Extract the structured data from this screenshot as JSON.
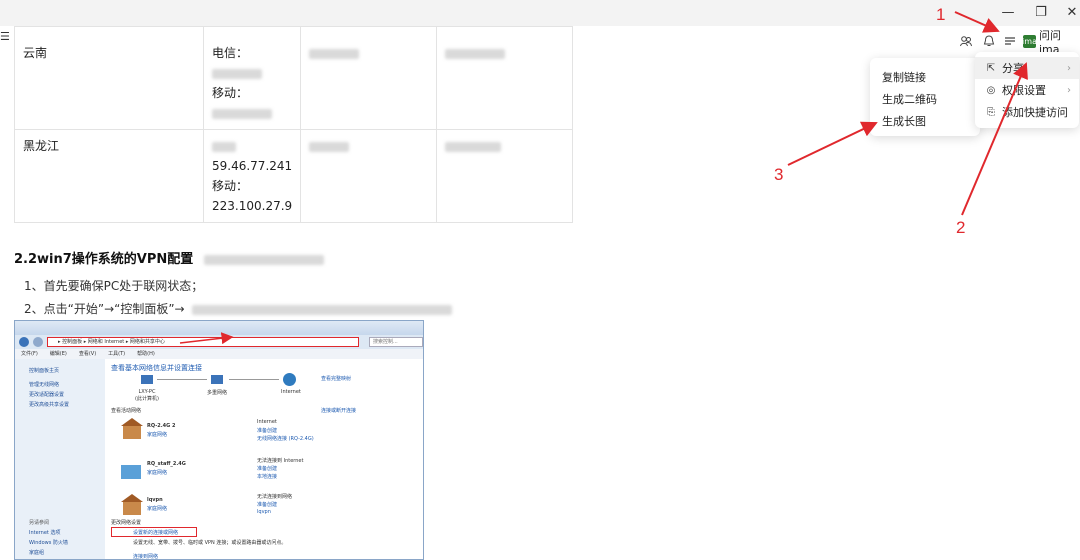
{
  "window": {
    "minimize_icon": "minimize-icon",
    "restore_icon": "restore-icon",
    "close_icon": "close-icon"
  },
  "left_toolbar": {
    "icon": "outline-icon"
  },
  "toolbar": {
    "user_name": "问问ima",
    "user_avatar_text": "ima"
  },
  "table": {
    "row1": {
      "region": "云南",
      "telecom_label": "电信：",
      "mobile_label": "移动："
    },
    "row2": {
      "region": "黑龙江",
      "ip1": "59.46.77.241",
      "mobile_label": "移动：",
      "ip2": "223.100.27.9"
    }
  },
  "section_heading": "2.2win7操作系统的VPN配置",
  "steps": [
    "1、首先要确保PC处于联网状态；",
    "2、点击“开始”→“控制面板”→"
  ],
  "embedded_screenshot": {
    "address_path": "▸ 控制面板 ▸ 网络和 Internet ▸ 网络和共享中心",
    "search_placeholder": "搜索控制...",
    "menu": [
      "文件(F)",
      "编辑(E)",
      "查看(V)",
      "工具(T)",
      "帮助(H)"
    ],
    "sidebar": [
      "控制面板主页",
      "管理无线网络",
      "更改适配器设置",
      "更改高级共享设置"
    ],
    "sidebar_bottom": [
      "另请参阅",
      "Internet 选项",
      "Windows 防火墙",
      "家庭组"
    ],
    "main_title": "查看基本网络信息并设置连接",
    "map_link": "查看完整映射",
    "map_nodes": [
      "LXY-PC\n(此计算机)",
      "多重网络",
      "Internet"
    ],
    "active_networks_label": "查看活动网络",
    "connect_disconnect": "连接或断开连接",
    "networks": [
      {
        "name": "RQ-2.4G  2",
        "type": "家庭网络",
        "access": "Internet",
        "group": "准备创建",
        "conn": "无线网络连接 (RQ-2.4G)"
      },
      {
        "name": "RQ_staff_2.4G",
        "type": "家庭网络",
        "access": "无法连接到 Internet",
        "group": "准备创建",
        "conn": "本地连接"
      },
      {
        "name": "lqvpn",
        "type": "家庭网络",
        "access": "无法连接到网络",
        "group": "准备创建",
        "conn": "lqvpn"
      }
    ],
    "change_settings_label": "更改网络设置",
    "setup_link": "设置新的连接或网络",
    "setup_desc": "设置无线、宽带、拨号、临时或 VPN 连接；或设置路由器或访问点。",
    "next_link": "连接到网络"
  },
  "menu_main": [
    {
      "icon": "share-icon",
      "label": "分享"
    },
    {
      "icon": "permission-icon",
      "label": "权限设置"
    },
    {
      "icon": "bookmark-icon",
      "label": "添加快捷访问"
    }
  ],
  "menu_sub": [
    "复制链接",
    "生成二维码",
    "生成长图"
  ],
  "annotations": [
    "1",
    "2",
    "3"
  ],
  "colors": {
    "annotation_red": "#e0282d",
    "link_blue": "#1e5bb1"
  }
}
